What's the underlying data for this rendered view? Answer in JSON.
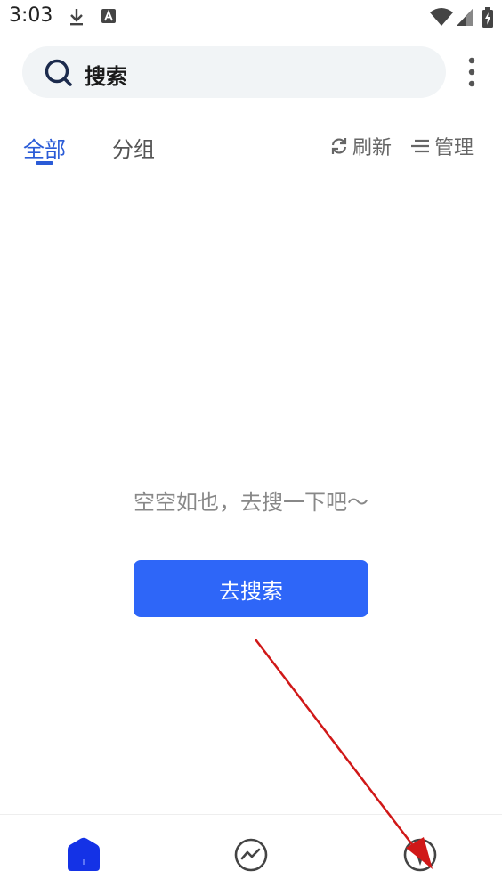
{
  "status_bar": {
    "time": "3:03",
    "icons": [
      "download-icon",
      "a-notification-icon",
      "wifi-icon",
      "signal-icon",
      "battery-icon"
    ]
  },
  "search": {
    "label": "搜索"
  },
  "tabs": [
    {
      "label": "全部",
      "active": true
    },
    {
      "label": "分组",
      "active": false
    }
  ],
  "actions": {
    "refresh_label": "刷新",
    "manage_label": "管理"
  },
  "empty_state": {
    "message": "空空如也，去搜一下吧～",
    "button_label": "去搜索"
  },
  "bottom_nav": {
    "items": [
      "home-icon",
      "trend-icon",
      "explore-icon"
    ],
    "active_index": 0
  },
  "colors": {
    "accent": "#2a5bd7",
    "button": "#2e66f8",
    "search_bg": "#f1f4f6",
    "nav_active": "#1432e6",
    "annotation_arrow": "#d01818"
  }
}
